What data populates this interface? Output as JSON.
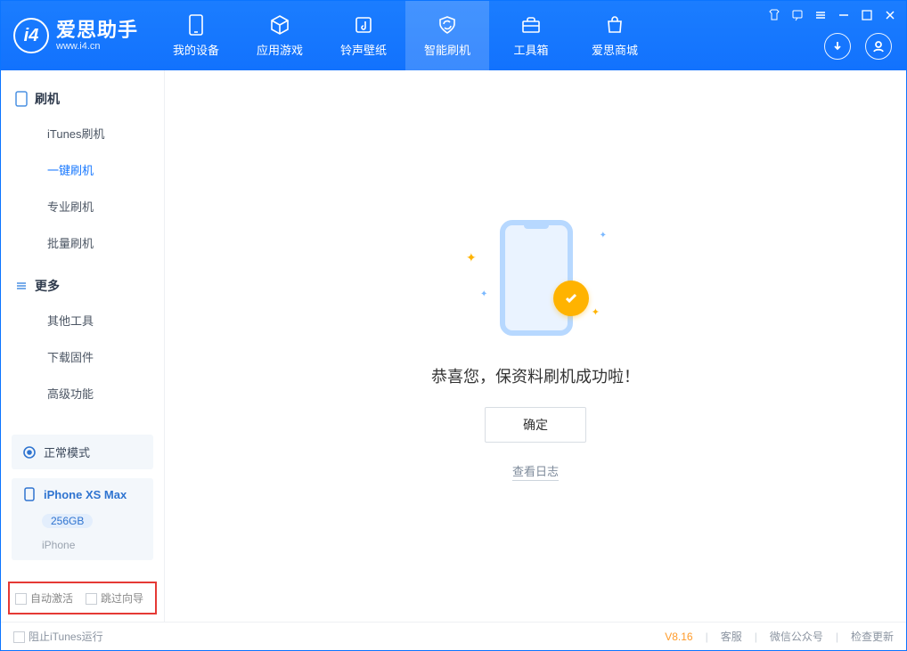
{
  "brand": {
    "title": "爱思助手",
    "subtitle": "www.i4.cn",
    "logo_letter": "i4"
  },
  "header_tabs": [
    {
      "label": "我的设备"
    },
    {
      "label": "应用游戏"
    },
    {
      "label": "铃声壁纸"
    },
    {
      "label": "智能刷机"
    },
    {
      "label": "工具箱"
    },
    {
      "label": "爱思商城"
    }
  ],
  "sidebar": {
    "group1_title": "刷机",
    "items1": [
      {
        "label": "iTunes刷机"
      },
      {
        "label": "一键刷机"
      },
      {
        "label": "专业刷机"
      },
      {
        "label": "批量刷机"
      }
    ],
    "group2_title": "更多",
    "items2": [
      {
        "label": "其他工具"
      },
      {
        "label": "下载固件"
      },
      {
        "label": "高级功能"
      }
    ]
  },
  "device": {
    "mode_label": "正常模式",
    "name": "iPhone XS Max",
    "storage": "256GB",
    "type": "iPhone"
  },
  "redbox": {
    "cb1": "自动激活",
    "cb2": "跳过向导"
  },
  "main": {
    "success_text": "恭喜您，保资料刷机成功啦！",
    "ok_button": "确定",
    "view_log": "查看日志"
  },
  "footer": {
    "block_itunes": "阻止iTunes运行",
    "version": "V8.16",
    "link1": "客服",
    "link2": "微信公众号",
    "link3": "检查更新"
  }
}
